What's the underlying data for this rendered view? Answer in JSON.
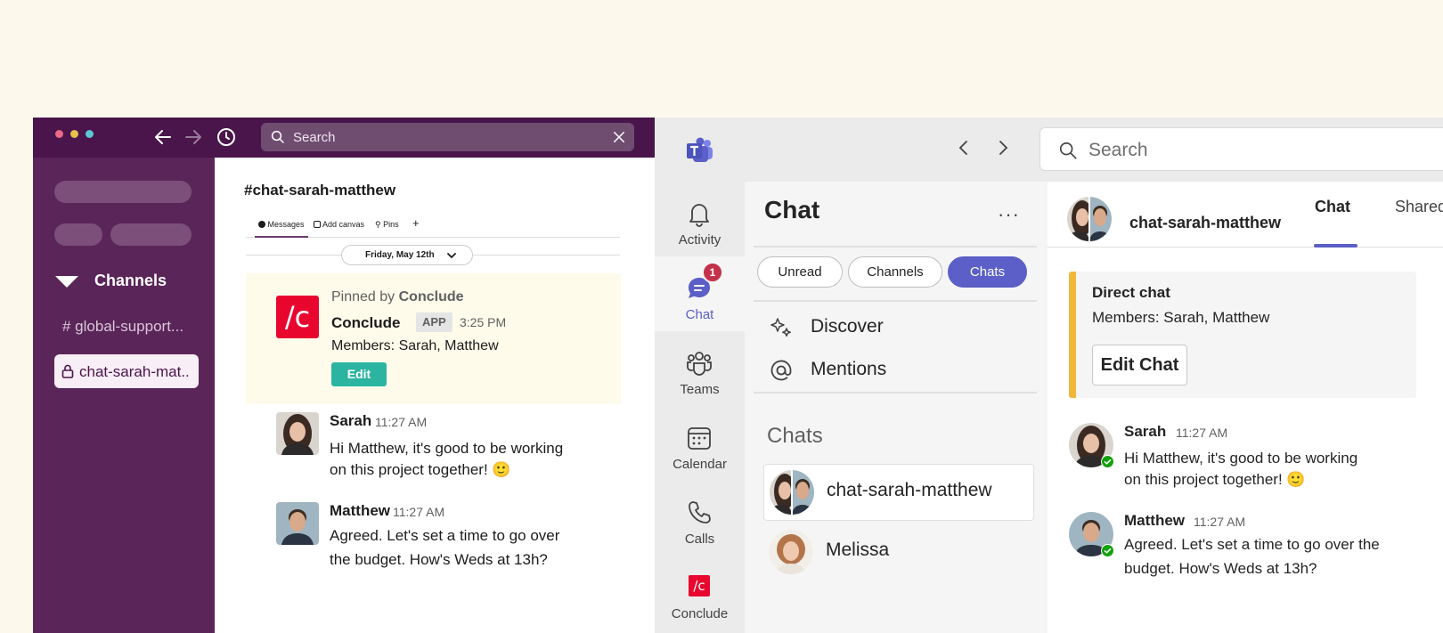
{
  "slack": {
    "search_placeholder": "Search",
    "sidebar": {
      "section_label": "Channels",
      "channel_global": "# global-support...",
      "channel_active": "chat-sarah-mat.."
    },
    "channel_title": "#chat-sarah-matthew",
    "tabs": [
      "Messages",
      "Add canvas",
      "Pins"
    ],
    "add_tab": "+",
    "date_label": "Friday, May 12th",
    "pinned": {
      "prefix": "Pinned by",
      "by": "Conclude",
      "logo": "/c",
      "app_name": "Conclude",
      "badge": "APP",
      "time": "3:25 PM",
      "members": "Members: Sarah, Matthew",
      "edit": "Edit"
    },
    "messages": [
      {
        "name": "Sarah",
        "time": "11:27 AM",
        "line1": "Hi Matthew, it's good to be working",
        "line2": "on this project together! 🙂"
      },
      {
        "name": "Matthew",
        "time": "11:27 AM",
        "line1": "Agreed. Let's set a time to go over",
        "line2": "the budget. How's Weds at 13h?"
      }
    ]
  },
  "teams": {
    "search_placeholder": "Search",
    "rail": {
      "activity": "Activity",
      "chat": "Chat",
      "chat_badge": "1",
      "teams": "Teams",
      "calendar": "Calendar",
      "calls": "Calls",
      "conclude": "Conclude",
      "conclude_logo": "/c"
    },
    "chatlist": {
      "title": "Chat",
      "more": "···",
      "filters": [
        "Unread",
        "Channels",
        "Chats"
      ],
      "discover": "Discover",
      "mentions": "Mentions",
      "section": "Chats",
      "items": [
        "chat-sarah-matthew",
        "Melissa"
      ]
    },
    "conversation": {
      "name": "chat-sarah-matthew",
      "tabs": [
        "Chat",
        "Shared"
      ],
      "card": {
        "title": "Direct chat",
        "members": "Members: Sarah, Matthew",
        "button": "Edit Chat"
      },
      "messages": [
        {
          "name": "Sarah",
          "time": "11:27 AM",
          "line1": "Hi Matthew, it's good to be working",
          "line2": "on this project together! 🙂"
        },
        {
          "name": "Matthew",
          "time": "11:27 AM",
          "line1": "Agreed. Let's set a time to go over the",
          "line2": "budget. How's Weds at 13h?"
        }
      ]
    }
  },
  "colors": {
    "slack_aubergine": "#4a154b",
    "slack_sidebar": "#5a2558",
    "teams_accent": "#5b5fc7",
    "conclude_red": "#e8062f",
    "edit_green": "#2bb5a0",
    "card_accent": "#f0b73a"
  }
}
